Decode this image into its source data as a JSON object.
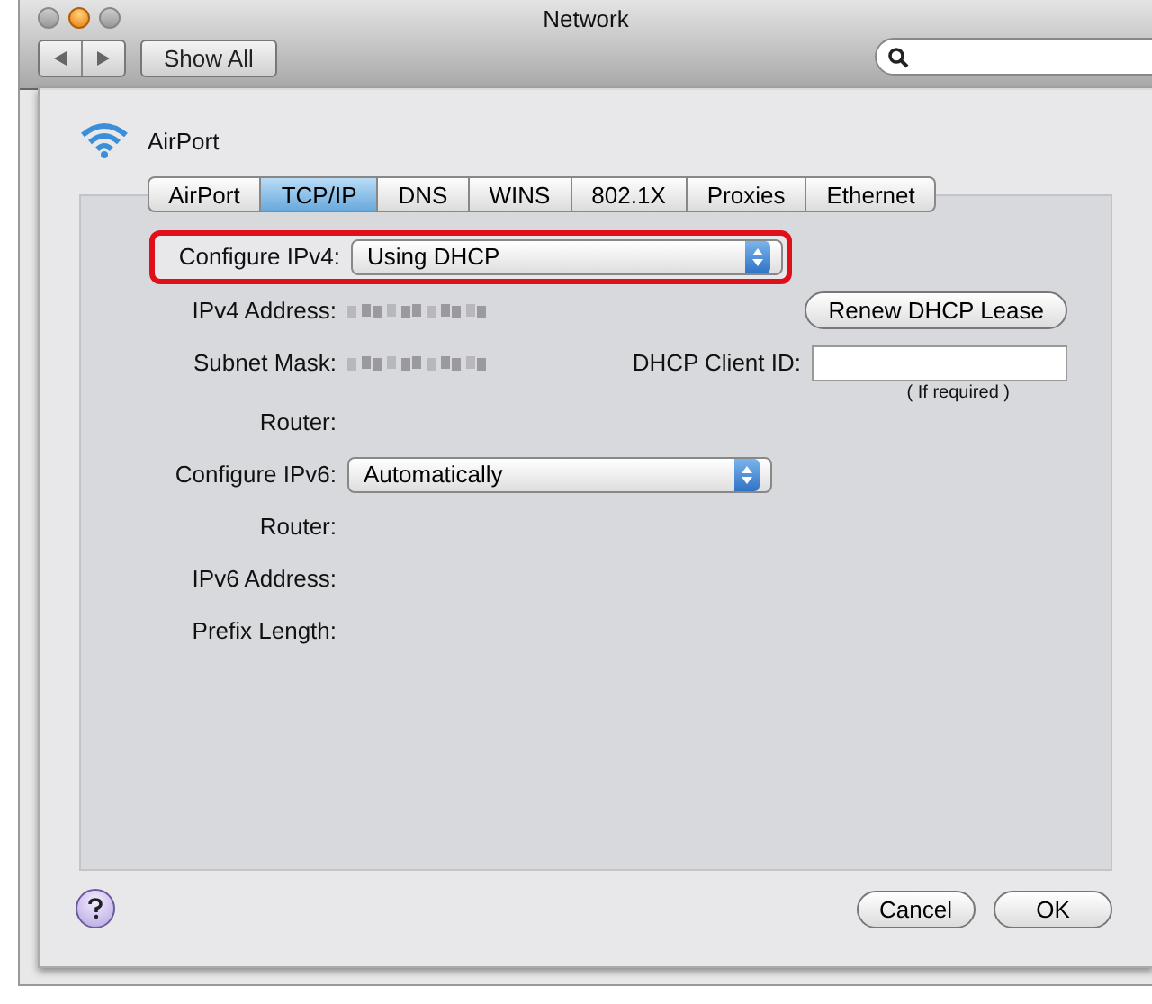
{
  "window": {
    "title": "Network"
  },
  "toolbar": {
    "show_all": "Show All"
  },
  "sheet": {
    "service": "AirPort",
    "tabs": [
      {
        "label": "AirPort",
        "selected": false
      },
      {
        "label": "TCP/IP",
        "selected": true
      },
      {
        "label": "DNS",
        "selected": false
      },
      {
        "label": "WINS",
        "selected": false
      },
      {
        "label": "802.1X",
        "selected": false
      },
      {
        "label": "Proxies",
        "selected": false
      },
      {
        "label": "Ethernet",
        "selected": false
      }
    ],
    "rows": [
      {
        "kind": "select",
        "label": "Configure IPv4:",
        "value": "Using DHCP",
        "highlighted": true
      },
      {
        "kind": "redacted",
        "label": "IPv4 Address:",
        "button": "Renew DHCP Lease"
      },
      {
        "kind": "redacted",
        "label": "Subnet Mask:",
        "side_label": "DHCP Client ID:"
      },
      {
        "kind": "hint",
        "text": "( If required )"
      },
      {
        "kind": "empty",
        "label": "Router:"
      },
      {
        "kind": "select",
        "label": "Configure IPv6:",
        "value": "Automatically",
        "highlighted": false
      },
      {
        "kind": "empty",
        "label": "Router:"
      },
      {
        "kind": "empty",
        "label": "IPv6 Address:"
      },
      {
        "kind": "empty",
        "label": "Prefix Length:"
      }
    ],
    "buttons": {
      "cancel": "Cancel",
      "ok": "OK"
    }
  }
}
